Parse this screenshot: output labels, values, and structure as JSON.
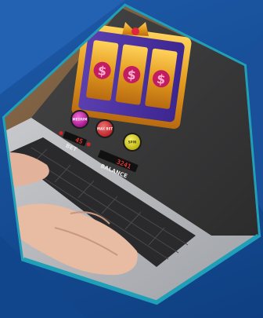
{
  "slot_game": {
    "reel_symbols": [
      "$",
      "$",
      "$"
    ],
    "buttons": [
      "MEDIUM",
      "MAX BET",
      "SPIN"
    ],
    "bet_label": "BET",
    "bet_value": "45",
    "balance_label": "BALANCE",
    "balance_value": "3241"
  },
  "colors": {
    "background_blue": "#1b55a3",
    "teal_border": "#1fa0b8",
    "screen": "#3c3c3d",
    "reel_gold": "#e7a92c",
    "button_purple": "#b5199c",
    "button_red": "#cf2b2e",
    "button_yellow": "#d8cf16"
  }
}
